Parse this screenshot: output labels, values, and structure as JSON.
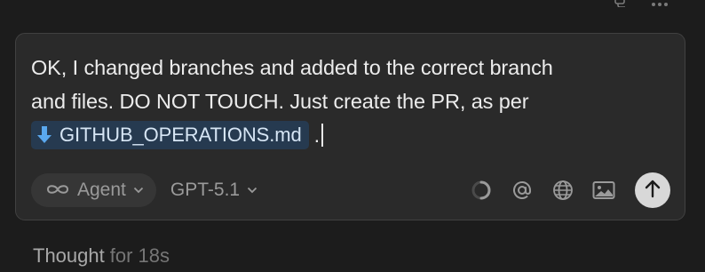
{
  "composer": {
    "message_line1": "OK, I changed branches and added to the correct branch",
    "message_line2": "and files. DO NOT TOUCH. Just create the PR, as per",
    "file_chip": {
      "icon": "download-arrow-icon",
      "label": "GITHUB_OPERATIONS.md"
    },
    "message_trailing": ".",
    "mode": {
      "icon": "infinity-icon",
      "label": "Agent"
    },
    "model": {
      "label": "GPT-5.1"
    },
    "tools": [
      "loading-spinner-icon",
      "mention-at-icon",
      "globe-icon",
      "image-icon"
    ],
    "send_icon": "arrow-up-icon"
  },
  "thought": {
    "label": "Thought",
    "duration": "for 18s"
  },
  "colors": {
    "background": "#1c1c1c",
    "composer_bg": "#2a2a2a",
    "composer_border": "#414141",
    "chip_bg": "#263a50",
    "chip_icon": "#5aa8ee",
    "send_bg": "#d8d8d8"
  }
}
